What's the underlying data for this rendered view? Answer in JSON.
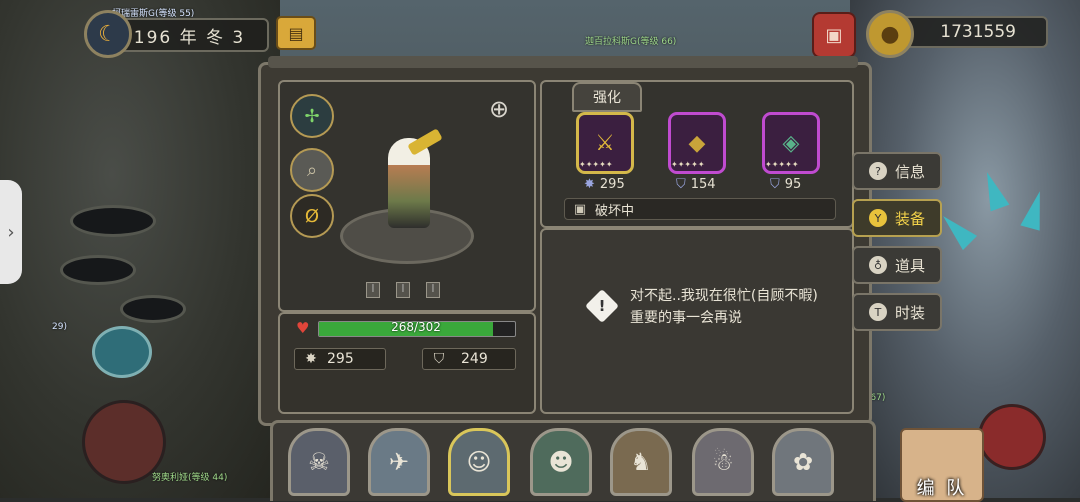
{
  "top_bar": {
    "date_text": "196 年 冬 3",
    "coins": "1731559",
    "npc_tag_left": "柯瑞雷斯G(等级 55)",
    "npc_tag_center": "迦百拉科斯G(等级 66)"
  },
  "character": {
    "hp_text": "268/302",
    "hp_fraction": 0.887,
    "attack": "295",
    "defense": "249"
  },
  "equipment": {
    "enhance_label": "强化",
    "slots": [
      {
        "value": "295",
        "stat_icon": "attack-icon",
        "rarity": "gold"
      },
      {
        "value": "154",
        "stat_icon": "defense-icon",
        "rarity": "purple"
      },
      {
        "value": "95",
        "stat_icon": "defense-icon",
        "rarity": "purple"
      }
    ],
    "status_text": "破坏中"
  },
  "message": {
    "text": "对不起..我现在很忙(自顾不暇)重要的事一会再说"
  },
  "tabs": [
    {
      "label": "信息",
      "icon": "info-icon",
      "active": false
    },
    {
      "label": "装备",
      "icon": "equip-icon",
      "active": true
    },
    {
      "label": "道具",
      "icon": "item-icon",
      "active": false
    },
    {
      "label": "时装",
      "icon": "costume-icon",
      "active": false
    }
  ],
  "team": {
    "label": "编 队"
  },
  "map_tags": {
    "left_level": "29)",
    "bottom_left": "努奥利娅(等级 44)",
    "bottom_right": "柯瑞蒂斯(等级 67)"
  }
}
